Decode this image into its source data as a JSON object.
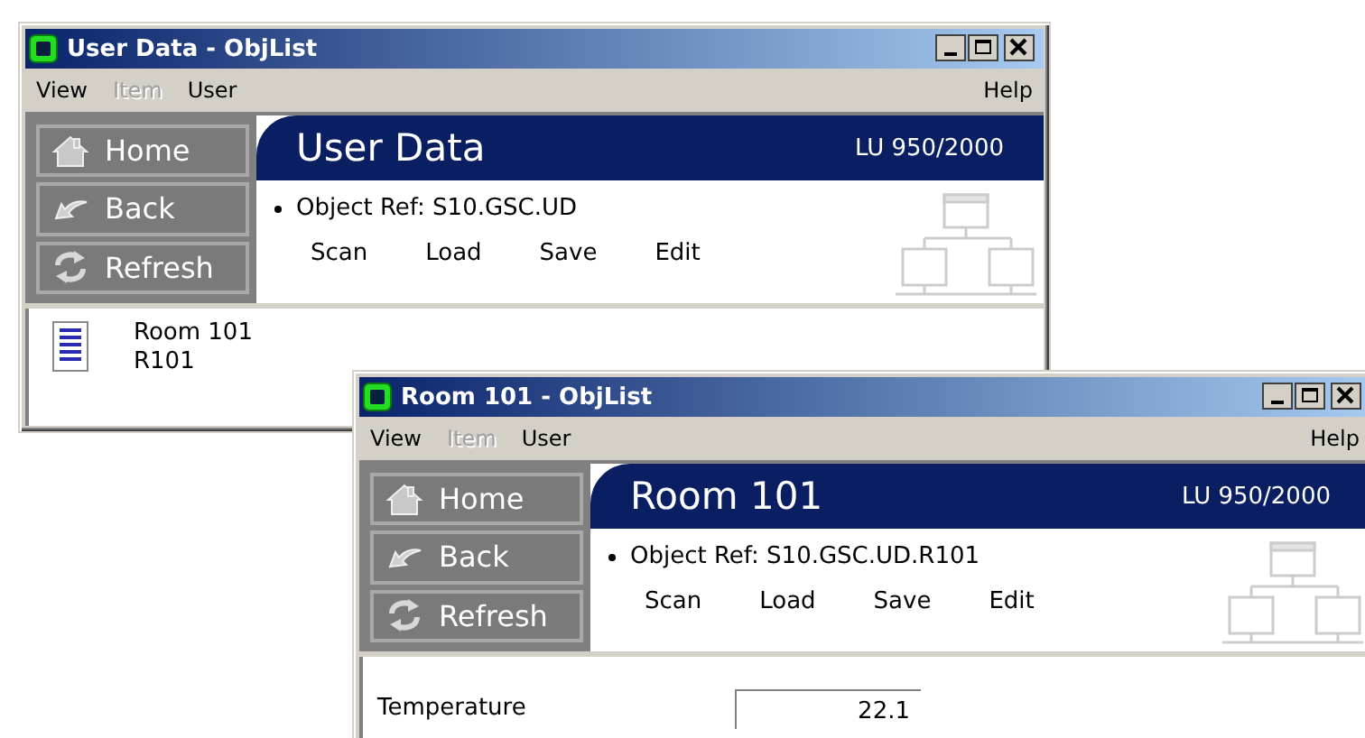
{
  "windows": [
    {
      "title": "User Data - ObjList",
      "menu": [
        {
          "label": "View",
          "disabled": false
        },
        {
          "label": "Item",
          "disabled": true
        },
        {
          "label": "User",
          "disabled": false
        }
      ],
      "help": "Help",
      "nav_buttons": [
        {
          "label": "Home",
          "kind": "home"
        },
        {
          "label": "Back",
          "kind": "back"
        },
        {
          "label": "Refresh",
          "kind": "refresh"
        }
      ],
      "header": {
        "title": "User Data",
        "license": "LU 950/2000"
      },
      "object_ref": "Object Ref: S10.GSC.UD",
      "actions": [
        "Scan",
        "Load",
        "Save",
        "Edit"
      ],
      "list": [
        {
          "name": "Room 101",
          "ref": "R101"
        }
      ]
    },
    {
      "title": "Room 101 - ObjList",
      "menu": [
        {
          "label": "View",
          "disabled": false
        },
        {
          "label": "Item",
          "disabled": true
        },
        {
          "label": "User",
          "disabled": false
        }
      ],
      "help": "Help",
      "nav_buttons": [
        {
          "label": "Home",
          "kind": "home"
        },
        {
          "label": "Back",
          "kind": "back"
        },
        {
          "label": "Refresh",
          "kind": "refresh"
        }
      ],
      "header": {
        "title": "Room 101",
        "license": "LU 950/2000"
      },
      "object_ref": "Object Ref: S10.GSC.UD.R101",
      "actions": [
        "Scan",
        "Load",
        "Save",
        "Edit"
      ],
      "fields": [
        {
          "label": "Temperature",
          "value": "22.1"
        }
      ]
    }
  ]
}
